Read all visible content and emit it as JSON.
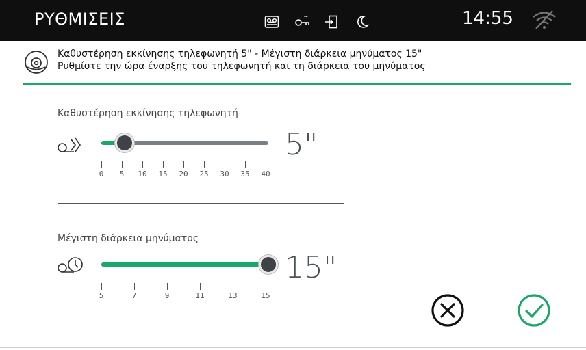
{
  "header": {
    "title": "ΡΥΘΜΙΣΕΙΣ",
    "status_icons": [
      "answering-machine-icon",
      "key-icon",
      "door-exit-icon",
      "moon-icon"
    ],
    "time": "14:55",
    "wifi_icon": "wifi-off-icon"
  },
  "info": {
    "line1": "Καθυστέρηση εκκίνησης τηλεφωνητή 5\" - Μέγιστη διάρκεια μηνύματος 15\"",
    "line2": "Ρυθμίστε την ώρα έναρξης του τηλεφωνητή και τη διάρκεια του μηνύματος",
    "icon": "answering-machine-icon"
  },
  "settings": [
    {
      "label": "Καθυστέρηση εκκίνησης τηλεφωνητή",
      "icon": "tape-play-icon",
      "value_display": "5\"",
      "value": 5,
      "min": 0,
      "max": 40,
      "ticks": [
        "0",
        "5",
        "10",
        "15",
        "20",
        "25",
        "30",
        "35",
        "40"
      ]
    },
    {
      "label": "Μέγιστη διάρκεια μηνύματος",
      "icon": "tape-timer-icon",
      "value_display": "15\"",
      "value": 15,
      "min": 5,
      "max": 15,
      "ticks": [
        "5",
        "7",
        "9",
        "11",
        "13",
        "15"
      ]
    }
  ],
  "buttons": {
    "cancel_icon": "cancel-circle-icon",
    "confirm_icon": "confirm-check-icon"
  },
  "colors": {
    "accent": "#1aa86a",
    "header_bg": "#0f0f0f",
    "track": "#7a7f83"
  }
}
